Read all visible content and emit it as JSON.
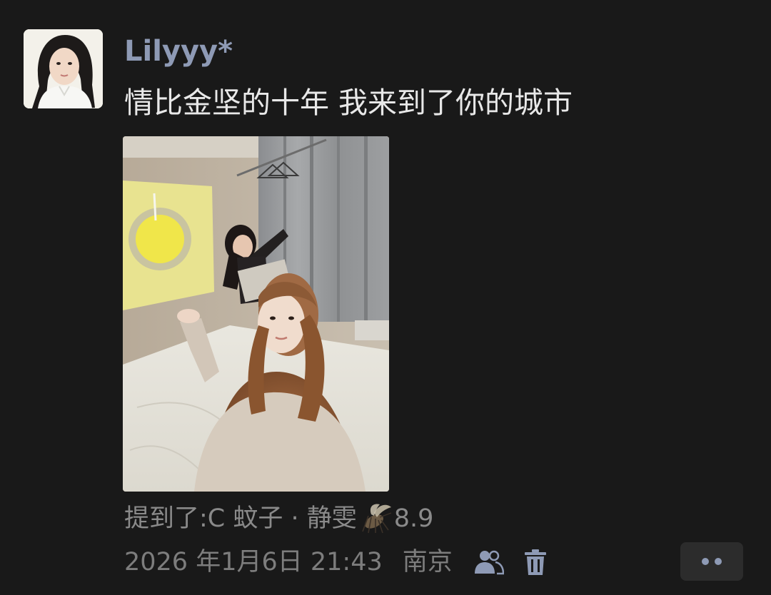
{
  "post": {
    "username": "Lilyyy*",
    "text": "情比金坚的十年 我来到了你的城市",
    "mention_prefix": "提到了: ",
    "mention_names": "C 蚊子 · 静雯",
    "mention_suffix": "8.9",
    "date": "2026 年1月6日 21:43",
    "location": "南京"
  },
  "icons": {
    "avatar": "avatar",
    "photo": "photo",
    "mosquito": "mosquito-emoji-icon",
    "people": "people-icon",
    "trash": "trash-icon",
    "more": "more-icon"
  },
  "colors": {
    "background": "#191919",
    "username": "#8e9ab5",
    "text": "#e8e8e8",
    "meta": "#7d7d7d",
    "icon": "#8e9ab5"
  }
}
